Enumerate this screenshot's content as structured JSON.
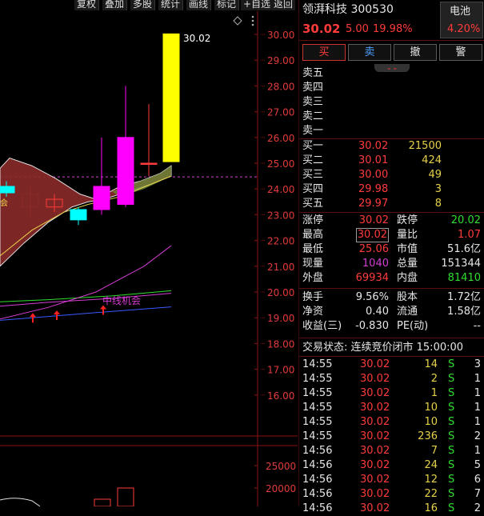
{
  "toolbar": {
    "buttons": [
      "复权",
      "叠加",
      "多股",
      "统计",
      "画线",
      "标记",
      "+自选",
      "返回"
    ]
  },
  "chart": {
    "price_ticks": [
      "30.00",
      "29.00",
      "28.00",
      "27.00",
      "26.00",
      "25.00",
      "24.00",
      "23.00",
      "22.00",
      "21.00",
      "20.00",
      "19.00",
      "18.00",
      "17.00",
      "16.00"
    ],
    "volume_ticks": [
      "25000",
      "20000"
    ],
    "high_label": "30.02",
    "annotation": "中线机会",
    "marker_text": "会",
    "colors": {
      "up": "#ff00ff",
      "limit": "#ffff00",
      "down": "#00ffff",
      "cloud": "#8b2a2a",
      "grid": "#8b1010"
    }
  },
  "quote": {
    "name": "领湃科技",
    "code": "300530",
    "price": "30.02",
    "change": "5.00",
    "change_pct": "19.98%",
    "sector_name": "电池",
    "sector_pct": "4.20%"
  },
  "trade_buttons": [
    "买",
    "卖",
    "撤",
    "警"
  ],
  "asks": [
    "卖五",
    "卖四",
    "卖三",
    "卖二",
    "卖一"
  ],
  "bids": [
    {
      "label": "买一",
      "price": "30.02",
      "vol": "21500"
    },
    {
      "label": "买二",
      "price": "30.01",
      "vol": "424"
    },
    {
      "label": "买三",
      "price": "30.00",
      "vol": "49"
    },
    {
      "label": "买四",
      "price": "29.98",
      "vol": "3"
    },
    {
      "label": "买五",
      "price": "29.97",
      "vol": "8"
    }
  ],
  "stats": [
    {
      "l1": "涨停",
      "v1": "30.02",
      "c1": "red",
      "l2": "跌停",
      "v2": "20.02",
      "c2": "green"
    },
    {
      "l1": "最高",
      "v1": "30.02",
      "c1": "red",
      "l2": "量比",
      "v2": "1.07",
      "c2": "red"
    },
    {
      "l1": "最低",
      "v1": "25.06",
      "c1": "red",
      "l2": "市值",
      "v2": "51.6亿",
      "c2": "white"
    },
    {
      "l1": "现量",
      "v1": "1040",
      "c1": "magenta",
      "l2": "总量",
      "v2": "151344",
      "c2": "white"
    },
    {
      "l1": "外盘",
      "v1": "69934",
      "c1": "red",
      "l2": "内盘",
      "v2": "81410",
      "c2": "green"
    }
  ],
  "fundamentals": [
    {
      "l1": "换手",
      "v1": "9.56%",
      "l2": "股本",
      "v2": "1.72亿"
    },
    {
      "l1": "净资",
      "v1": "0.40",
      "l2": "流通",
      "v2": "1.58亿"
    },
    {
      "l1": "收益(三)",
      "v1": "-0.830",
      "l2": "PE(动)",
      "v2": "--"
    }
  ],
  "trade_status": "交易状态: 连续竞价闭市 15:00:00",
  "ticks": [
    {
      "time": "14:55",
      "price": "30.02",
      "vol": "14",
      "bs": "S",
      "n": "3"
    },
    {
      "time": "14:55",
      "price": "30.02",
      "vol": "2",
      "bs": "S",
      "n": "1"
    },
    {
      "time": "14:55",
      "price": "30.02",
      "vol": "1",
      "bs": "S",
      "n": "1"
    },
    {
      "time": "14:55",
      "price": "30.02",
      "vol": "10",
      "bs": "S",
      "n": "1"
    },
    {
      "time": "14:55",
      "price": "30.02",
      "vol": "10",
      "bs": "S",
      "n": "1"
    },
    {
      "time": "14:55",
      "price": "30.02",
      "vol": "236",
      "bs": "S",
      "n": "2"
    },
    {
      "time": "14:56",
      "price": "30.02",
      "vol": "7",
      "bs": "S",
      "n": "1"
    },
    {
      "time": "14:56",
      "price": "30.02",
      "vol": "24",
      "bs": "S",
      "n": "5"
    },
    {
      "time": "14:56",
      "price": "30.02",
      "vol": "12",
      "bs": "S",
      "n": "6"
    },
    {
      "time": "14:56",
      "price": "30.02",
      "vol": "22",
      "bs": "S",
      "n": "7"
    },
    {
      "time": "14:56",
      "price": "30.02",
      "vol": "16",
      "bs": "S",
      "n": "2"
    }
  ]
}
